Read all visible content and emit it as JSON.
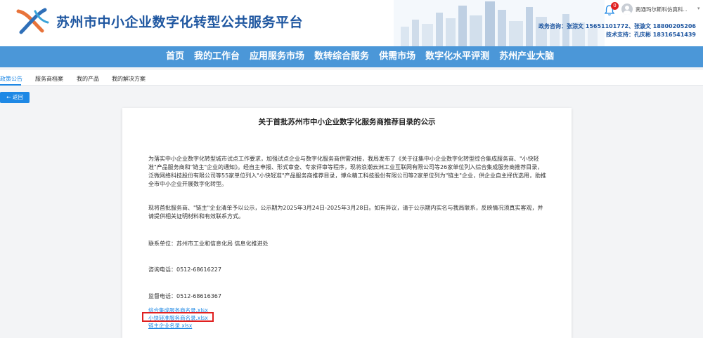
{
  "header": {
    "site_title": "苏州市中小企业数字化转型公共服务平台",
    "notification_count": "0",
    "user_name": "南通玛尔斯科仿真科...",
    "contact_business": "政务咨询：张淙文 15651101772、张漩文 18800205206",
    "contact_tech": "技术支持：孔庆彬 18316541439"
  },
  "nav": {
    "items": [
      "首页",
      "我的工作台",
      "应用服务市场",
      "数转综合服务",
      "供需市场",
      "数字化水平评测",
      "苏州产业大脑"
    ]
  },
  "subtabs": {
    "items": [
      "政策公告",
      "服务商档案",
      "我的产品",
      "我的解决方案"
    ],
    "active_index": 0
  },
  "back_button": "← 返回",
  "article": {
    "title": "关于首批苏州市中小企业数字化服务商推荐目录的公示",
    "paragraph1": "为落实中小企业数字化转型城市试点工作要求，加强试点企业与数字化服务商供需对接，我局发布了《关于征集中小企业数字化转型综合集成服务商、\"小快轻准\"产品服务商和\"链主\"企业的通知》。经自主申报、形式审查、专家评审等程序，现将浪潮云洲工业互联网有限公司等26家单位列入综合集成服务商推荐目录，泛微网络科技股份有限公司等55家单位列入\"小快轻准\"产品服务商推荐目录，博众精工科技股份有限公司等2家单位列为\"链主\"企业，供企业自主择优选用，助推全市中小企业开展数字化转型。",
    "paragraph2": "现将首批服务商、\"链主\"企业清单予以公示，公示期为2025年3月24日-2025年3月28日。如有异议，请于公示期内实名与我局联系，反映情况须真实客观，并请提供相关证明材料和有效联系方式。",
    "contact_unit": "联系单位：苏州市工业和信息化局 信息化推进处",
    "consult_phone": "咨询电话：0512-68616227",
    "supervise_phone": "监督电话：0512-68616367",
    "attachments": [
      "综合集成服务商名录.xlsx",
      "小快轻准服务商名录.xlsx",
      "链主企业名录.xlsx"
    ]
  },
  "colors": {
    "brand_blue": "#1e56a0",
    "nav_bar": "#4b97d8",
    "link_blue": "#1e88e5",
    "highlight_red": "#e02020"
  }
}
